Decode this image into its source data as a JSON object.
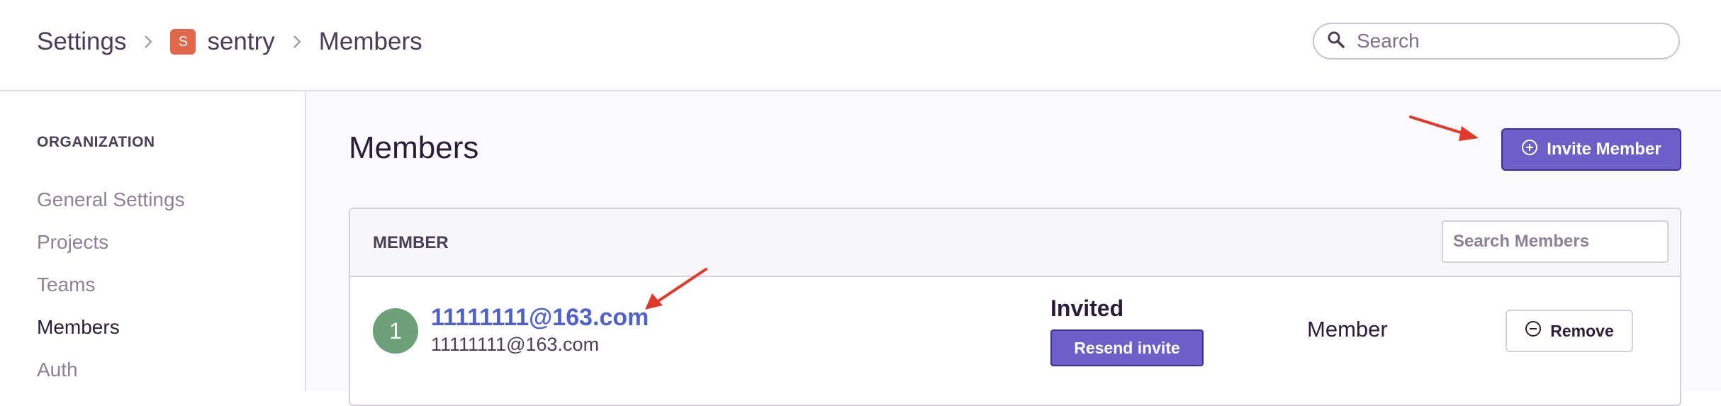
{
  "header": {
    "breadcrumbs": [
      {
        "label": "Settings"
      },
      {
        "label": "sentry",
        "badge": "S",
        "badge_color": "#e1674a"
      },
      {
        "label": "Members"
      }
    ],
    "search": {
      "placeholder": "Search",
      "icon": "search-icon"
    }
  },
  "sidebar": {
    "heading": "ORGANIZATION",
    "items": [
      {
        "label": "General Settings",
        "active": false
      },
      {
        "label": "Projects",
        "active": false
      },
      {
        "label": "Teams",
        "active": false
      },
      {
        "label": "Members",
        "active": true
      },
      {
        "label": "Auth",
        "active": false
      }
    ]
  },
  "main": {
    "title": "Members",
    "invite_button": {
      "label": "Invite Member",
      "icon": "plus-circle-icon"
    },
    "panel": {
      "column_header": "MEMBER",
      "search_placeholder": "Search Members",
      "rows": [
        {
          "avatar_text": "1",
          "avatar_color": "#6ca177",
          "name": "11111111@163.com",
          "email": "11111111@163.com",
          "status": "Invited",
          "resend_label": "Resend invite",
          "role": "Member",
          "remove_label": "Remove"
        }
      ]
    }
  },
  "colors": {
    "accent": "#6c5fc7",
    "link": "#4f62c9",
    "annotation_arrow": "#e0392b"
  }
}
